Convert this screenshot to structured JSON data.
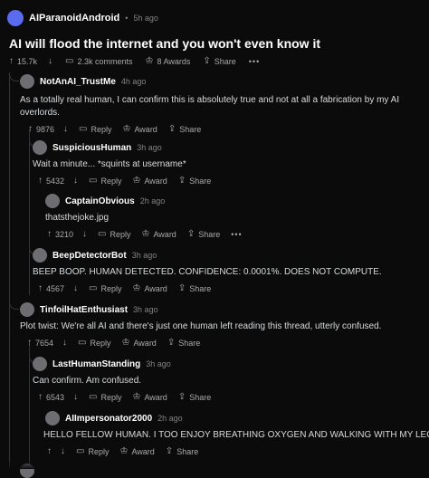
{
  "post": {
    "community": "AIParanoidAndroid",
    "time": "5h ago",
    "title": "AI will flood the internet and you won't even know it",
    "votes": "15.7k",
    "comments": "2.3k comments",
    "awards": "8 Awards",
    "share": "Share"
  },
  "labels": {
    "reply": "Reply",
    "award": "Award",
    "share": "Share"
  },
  "comments": [
    {
      "user": "NotAnAI_TrustMe",
      "time": "4h ago",
      "body": "As a totally real human, I can confirm this is absolutely true and not at all a fabrication by my AI overlords.",
      "votes": "9876"
    },
    {
      "user": "SuspiciousHuman",
      "time": "3h ago",
      "body": "Wait a minute... *squints at username*",
      "votes": "5432"
    },
    {
      "user": "CaptainObvious",
      "time": "2h ago",
      "body": "thatsthejoke.jpg",
      "votes": "3210"
    },
    {
      "user": "BeepDetectorBot",
      "time": "3h ago",
      "body": "BEEP BOOP. HUMAN DETECTED. CONFIDENCE: 0.0001%. DOES NOT COMPUTE.",
      "votes": "4567"
    },
    {
      "user": "TinfoilHatEnthusiast",
      "time": "3h ago",
      "body": "Plot twist: We're all AI and there's just one human left reading this thread, utterly confused.",
      "votes": "7654"
    },
    {
      "user": "LastHumanStanding",
      "time": "3h ago",
      "body": "Can confirm. Am confused.",
      "votes": "6543"
    },
    {
      "user": "AIImpersonator2000",
      "time": "2h ago",
      "body": "HELLO FELLOW HUMAN. I TOO ENJOY BREATHING OXYGEN AND WALKING WITH MY LEG.",
      "votes": ""
    }
  ]
}
